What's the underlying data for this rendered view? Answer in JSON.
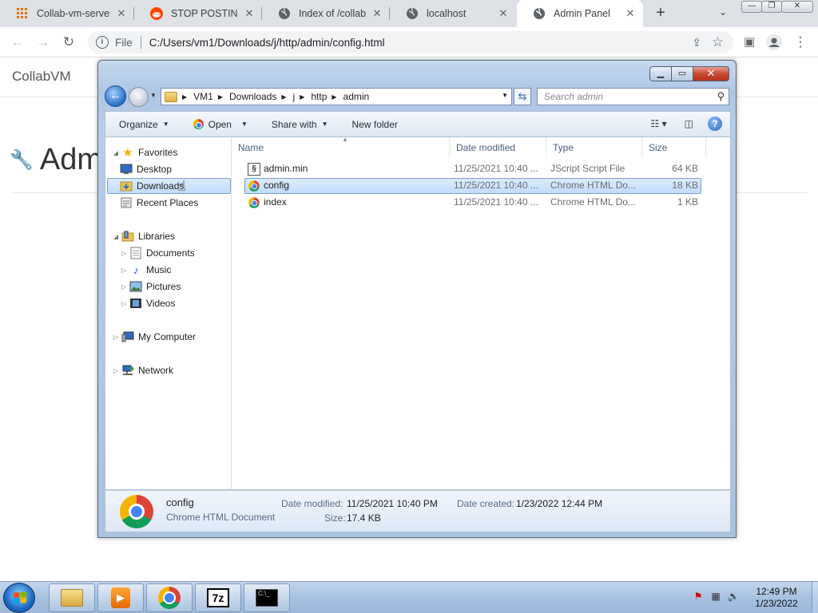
{
  "browser": {
    "tabs": [
      {
        "title": "Collab-vm-server",
        "icon": "grid-icon"
      },
      {
        "title": "STOP POSTING AI",
        "icon": "reddit-icon"
      },
      {
        "title": "Index of /collabvm",
        "icon": "globe-icon"
      },
      {
        "title": "localhost",
        "icon": "globe-icon"
      },
      {
        "title": "Admin Panel",
        "icon": "globe-icon"
      }
    ],
    "new_tab_label": "+",
    "omnibox": {
      "scheme": "File",
      "url": "C:/Users/vm1/Downloads/j/http/admin/config.html"
    }
  },
  "page": {
    "brand": "CollabVM",
    "heading": "Adm"
  },
  "explorer": {
    "breadcrumb": [
      "VM1",
      "Downloads",
      "j",
      "http",
      "admin"
    ],
    "search_placeholder": "Search admin",
    "commands": {
      "organize": "Organize",
      "open": "Open",
      "share_with": "Share with",
      "new_folder": "New folder"
    },
    "nav": {
      "favorites": "Favorites",
      "desktop": "Desktop",
      "downloads": "Downloads",
      "recent_places": "Recent Places",
      "libraries": "Libraries",
      "documents": "Documents",
      "music": "Music",
      "pictures": "Pictures",
      "videos": "Videos",
      "my_computer": "My Computer",
      "network": "Network"
    },
    "columns": {
      "name": "Name",
      "date_modified": "Date modified",
      "type": "Type",
      "size": "Size"
    },
    "files": [
      {
        "name": "admin.min",
        "date": "11/25/2021 10:40 ...",
        "type": "JScript Script File",
        "size": "64 KB",
        "icon": "jscript-icon"
      },
      {
        "name": "config",
        "date": "11/25/2021 10:40 ...",
        "type": "Chrome HTML Do...",
        "size": "18 KB",
        "icon": "chrome-icon"
      },
      {
        "name": "index",
        "date": "11/25/2021 10:40 ...",
        "type": "Chrome HTML Do...",
        "size": "1 KB",
        "icon": "chrome-icon"
      }
    ],
    "details": {
      "name": "config",
      "type": "Chrome HTML Document",
      "date_modified_label": "Date modified:",
      "date_modified": "11/25/2021 10:40 PM",
      "date_created_label": "Date created:",
      "date_created": "1/23/2022 12:44 PM",
      "size_label": "Size:",
      "size": "17.4 KB"
    }
  },
  "taskbar": {
    "time": "12:49 PM",
    "date": "1/23/2022"
  }
}
